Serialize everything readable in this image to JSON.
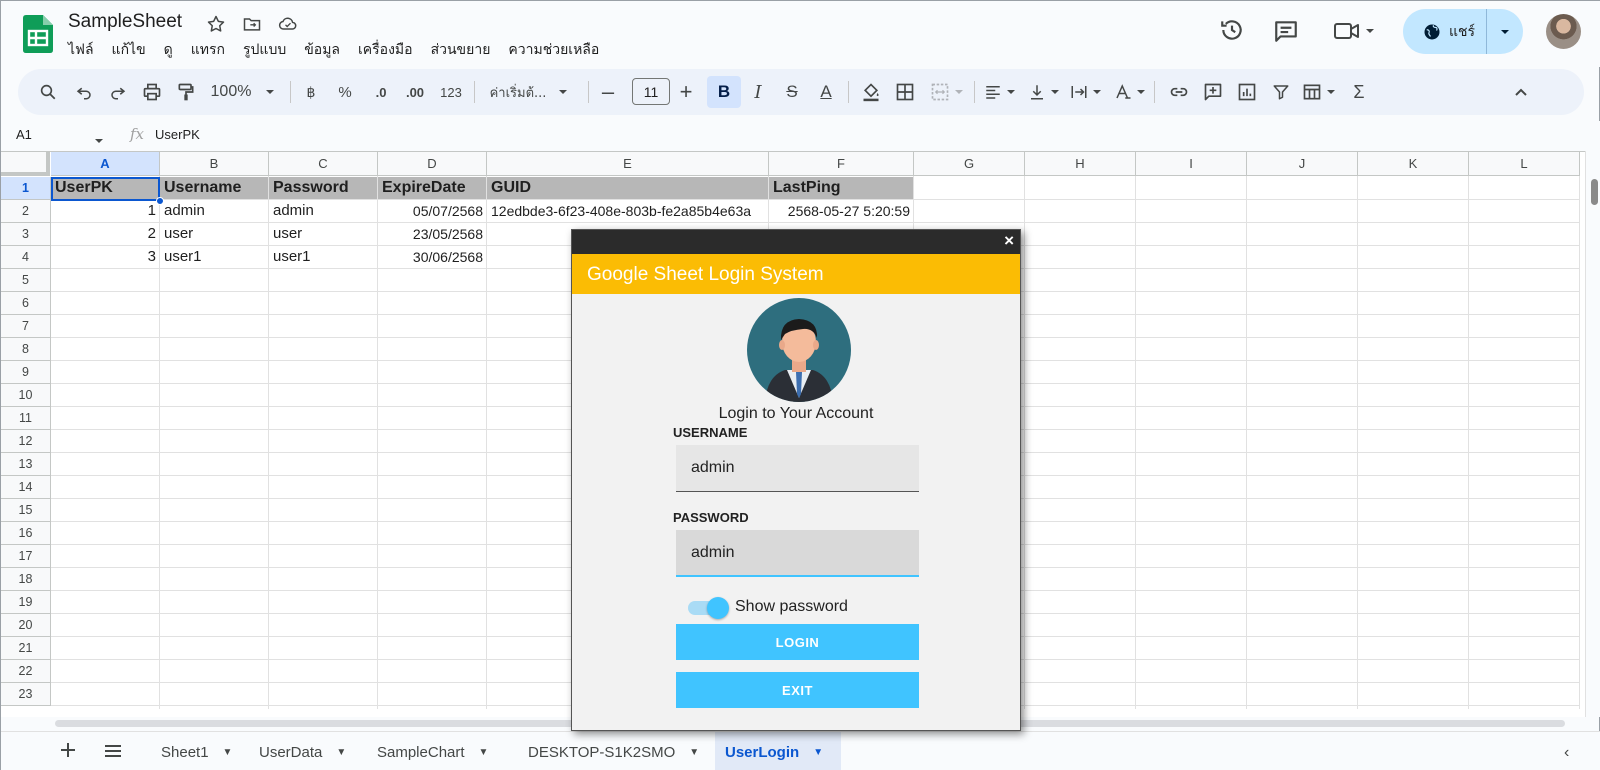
{
  "header": {
    "doc_title": "SampleSheet",
    "menu": [
      "ไฟล์",
      "แก้ไข",
      "ดู",
      "แทรก",
      "รูปแบบ",
      "ข้อมูล",
      "เครื่องมือ",
      "ส่วนขยาย",
      "ความช่วยเหลือ"
    ],
    "share_label": "แชร์"
  },
  "toolbar": {
    "zoom": "100%",
    "currency": "฿",
    "percent": "%",
    "dec_decrease": ".0",
    "dec_increase": ".00",
    "number_format": "123",
    "font_name": "ค่าเริ่มต้...",
    "font_size": "11",
    "bold": "B",
    "italic": "I",
    "strike": "S",
    "text_color": "A",
    "accent": "#0b57d0"
  },
  "formula_bar": {
    "cell_ref": "A1",
    "fx": "fx",
    "value": "UserPK"
  },
  "grid": {
    "columns": [
      "A",
      "B",
      "C",
      "D",
      "E",
      "F",
      "G",
      "H",
      "I",
      "J",
      "K",
      "L"
    ],
    "rows": [
      "1",
      "2",
      "3",
      "4",
      "5",
      "6",
      "7",
      "8",
      "9",
      "10",
      "11",
      "12",
      "13",
      "14",
      "15",
      "16",
      "17",
      "18",
      "19",
      "20",
      "21",
      "22",
      "23"
    ],
    "header_row": [
      "UserPK",
      "Username",
      "Password",
      "ExpireDate",
      "GUID",
      "LastPing"
    ],
    "data": [
      [
        "1",
        "admin",
        "admin",
        "05/07/2568",
        "12edbde3-6f23-408e-803b-fe2a85b4e63a",
        "2568-05-27 5:20:59"
      ],
      [
        "2",
        "user",
        "user",
        "23/05/2568",
        "",
        ""
      ],
      [
        "3",
        "user1",
        "user1",
        "30/06/2568",
        "",
        ""
      ]
    ]
  },
  "tabs": {
    "sheets": [
      "Sheet1",
      "UserData",
      "SampleChart",
      "DESKTOP-S1K2SMO",
      "UserLogin"
    ],
    "active": "UserLogin"
  },
  "dialog": {
    "title": "Google Sheet Login System",
    "subtitle": "Login to Your Account",
    "username_label": "USERNAME",
    "username_value": "admin",
    "password_label": "PASSWORD",
    "password_value": "admin",
    "show_password_label": "Show password",
    "show_password_on": true,
    "login_button": "LOGIN",
    "exit_button": "EXIT",
    "close_glyph": "×",
    "banner_color": "#fbbc04",
    "button_color": "#40c4ff"
  }
}
